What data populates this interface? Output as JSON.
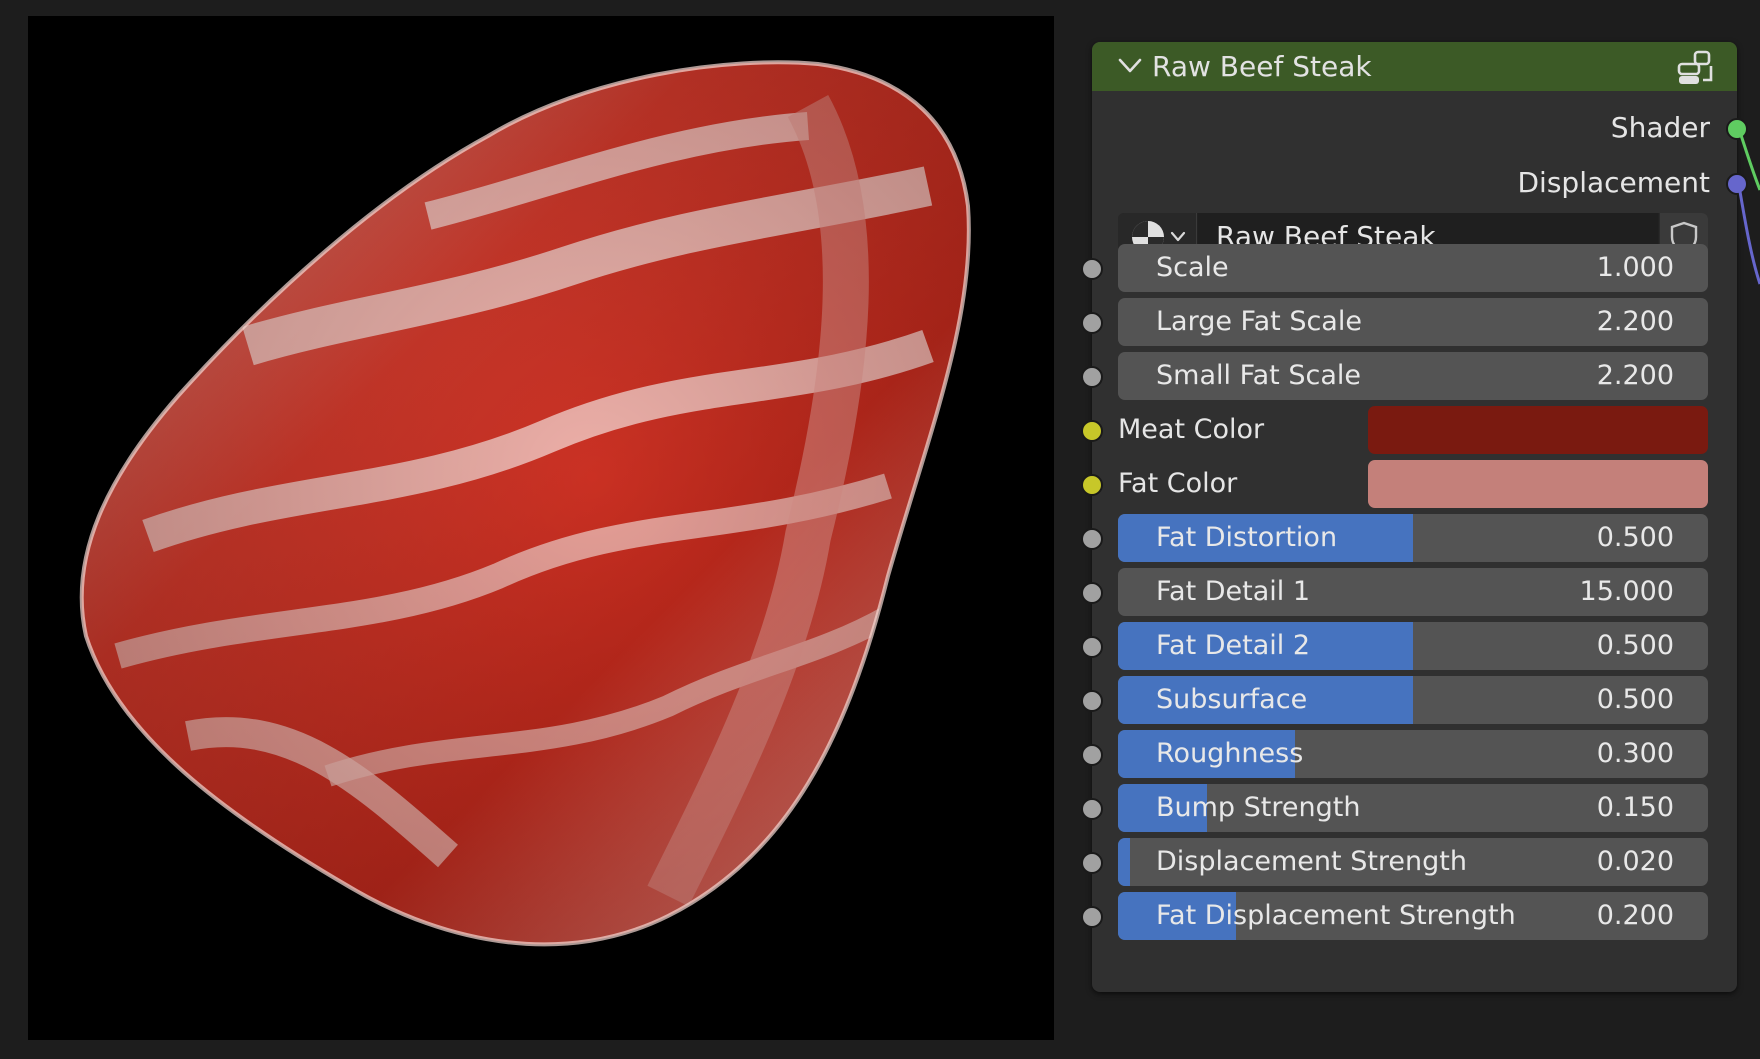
{
  "node": {
    "title": "Raw Beef Steak",
    "header_color": "#3c5a26",
    "outputs": [
      {
        "label": "Shader",
        "socket_color": "#5fcc61"
      },
      {
        "label": "Displacement",
        "socket_color": "#6666cc"
      }
    ],
    "material": {
      "name": "Raw Beef Steak",
      "type_icon": "material-sphere-icon",
      "fake_user_icon": "shield-icon"
    },
    "params": [
      {
        "label": "Scale",
        "value": "1.000",
        "fill": 0
      },
      {
        "label": "Large Fat Scale",
        "value": "2.200",
        "fill": 0
      },
      {
        "label": "Small Fat Scale",
        "value": "2.200",
        "fill": 0
      },
      {
        "label": "Fat Distortion",
        "value": "0.500",
        "fill": 0.5
      },
      {
        "label": "Fat Detail 1",
        "value": "15.000",
        "fill": 0
      },
      {
        "label": "Fat Detail 2",
        "value": "0.500",
        "fill": 0.5
      },
      {
        "label": "Subsurface",
        "value": "0.500",
        "fill": 0.5
      },
      {
        "label": "Roughness",
        "value": "0.300",
        "fill": 0.3
      },
      {
        "label": "Bump Strength",
        "value": "0.150",
        "fill": 0.15
      },
      {
        "label": "Displacement Strength",
        "value": "0.020",
        "fill": 0.02
      },
      {
        "label": "Fat Displacement Strength",
        "value": "0.200",
        "fill": 0.2
      }
    ],
    "colors": [
      {
        "label": "Meat Color",
        "value": "#7a1a10"
      },
      {
        "label": "Fat Color",
        "value": "#c4807a"
      }
    ],
    "socket_colors": {
      "float": "#a1a1a1",
      "color": "#c7c729"
    },
    "accent": "#4673bf"
  }
}
